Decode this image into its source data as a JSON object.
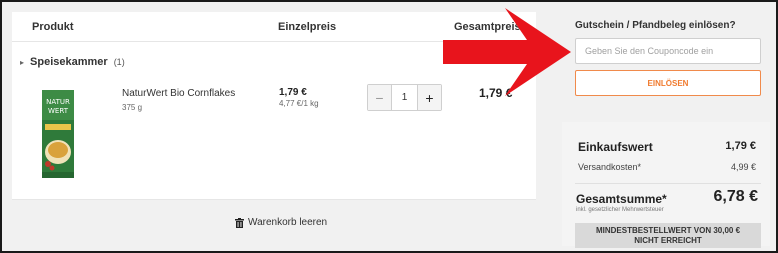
{
  "cart": {
    "headers": {
      "product": "Produkt",
      "unit_price": "Einzelpreis",
      "total": "Gesamtpreis"
    },
    "category": {
      "name": "Speisekammer",
      "count": "(1)"
    },
    "item": {
      "name": "NaturWert Bio Cornflakes",
      "weight": "375 g",
      "unit_price": "1,79 €",
      "base_price": "4,77 €/1 kg",
      "quantity": "1",
      "total": "1,79 €",
      "image_text": {
        "line1": "NATUR",
        "line2": "WERT"
      }
    },
    "clear_label": "Warenkorb leeren"
  },
  "coupon": {
    "title": "Gutschein / Pfandbeleg einlösen?",
    "placeholder": "Geben Sie den Couponcode ein",
    "button": "EINLÖSEN"
  },
  "summary": {
    "subtotal_label": "Einkaufswert",
    "subtotal": "1,79 €",
    "shipping_label": "Versandkosten*",
    "shipping": "4,99 €",
    "grand_label": "Gesamtsumme*",
    "grand_total": "6,78 €",
    "tax_note": "inkl. gesetzlicher Mehrwertsteuer",
    "min_order_line1": "MINDESTBESTELLWERT VON 30,00 €",
    "min_order_line2": "NICHT ERREICHT"
  },
  "colors": {
    "accent": "#f07a2e",
    "arrow": "#e8141c"
  }
}
